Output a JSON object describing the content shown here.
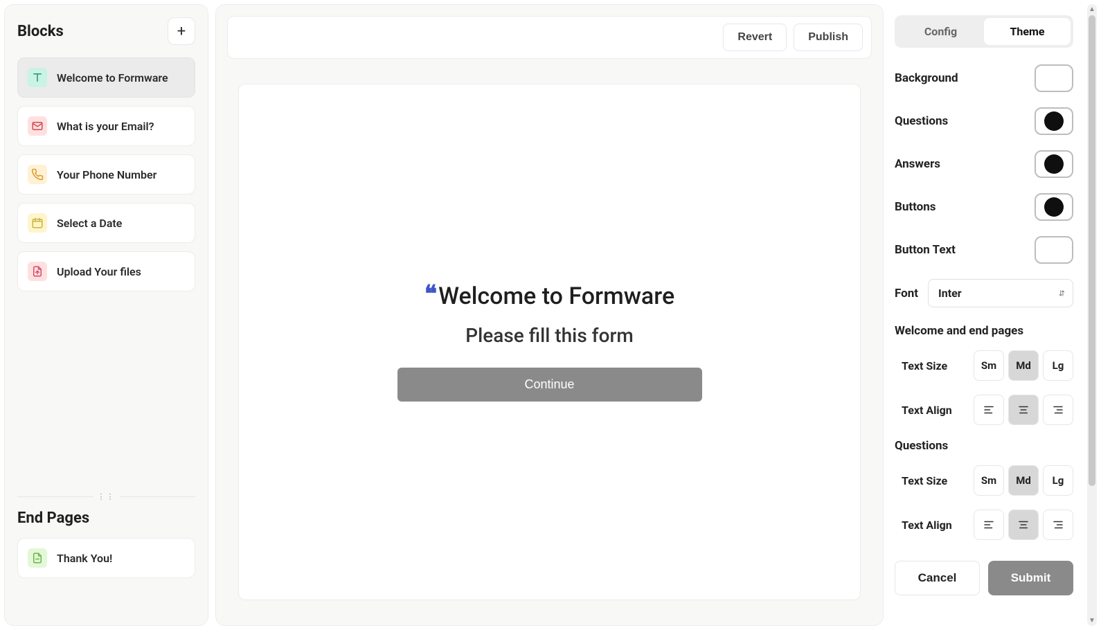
{
  "left": {
    "blocks_title": "Blocks",
    "add_glyph": "+",
    "items": [
      {
        "label": "Welcome to Formware",
        "icon": "text-icon",
        "active": true,
        "color_class": "bi-welcome"
      },
      {
        "label": "What is your Email?",
        "icon": "mail-icon",
        "active": false,
        "color_class": "bi-email"
      },
      {
        "label": "Your Phone Number",
        "icon": "phone-icon",
        "active": false,
        "color_class": "bi-phone"
      },
      {
        "label": "Select a Date",
        "icon": "calendar-icon",
        "active": false,
        "color_class": "bi-date"
      },
      {
        "label": "Upload Your files",
        "icon": "upload-icon",
        "active": false,
        "color_class": "bi-upload"
      }
    ],
    "endpages_title": "End Pages",
    "endpages": [
      {
        "label": "Thank You!",
        "icon": "document-icon",
        "color_class": "bi-thank"
      }
    ]
  },
  "center": {
    "revert_label": "Revert",
    "publish_label": "Publish",
    "title": "Welcome to Formware",
    "subtitle": "Please fill this form",
    "continue_label": "Continue"
  },
  "right": {
    "tabs": {
      "config": "Config",
      "theme": "Theme",
      "active": "theme"
    },
    "colors": [
      {
        "label": "Background",
        "value": "#ffffff"
      },
      {
        "label": "Questions",
        "value": "#0f0f0f"
      },
      {
        "label": "Answers",
        "value": "#0f0f0f"
      },
      {
        "label": "Buttons",
        "value": "#0f0f0f"
      },
      {
        "label": "Button Text",
        "value": "#ffffff"
      }
    ],
    "font_label": "Font",
    "font_value": "Inter",
    "sections": [
      {
        "title": "Welcome and end pages",
        "text_size": {
          "label": "Text Size",
          "options": [
            "Sm",
            "Md",
            "Lg"
          ],
          "active": "Md"
        },
        "text_align": {
          "label": "Text Align",
          "options": [
            "left",
            "center",
            "right"
          ],
          "active": "center"
        }
      },
      {
        "title": "Questions",
        "text_size": {
          "label": "Text Size",
          "options": [
            "Sm",
            "Md",
            "Lg"
          ],
          "active": "Md"
        },
        "text_align": {
          "label": "Text Align",
          "options": [
            "left",
            "center",
            "right"
          ],
          "active": "center"
        }
      }
    ],
    "cancel_label": "Cancel",
    "submit_label": "Submit"
  }
}
